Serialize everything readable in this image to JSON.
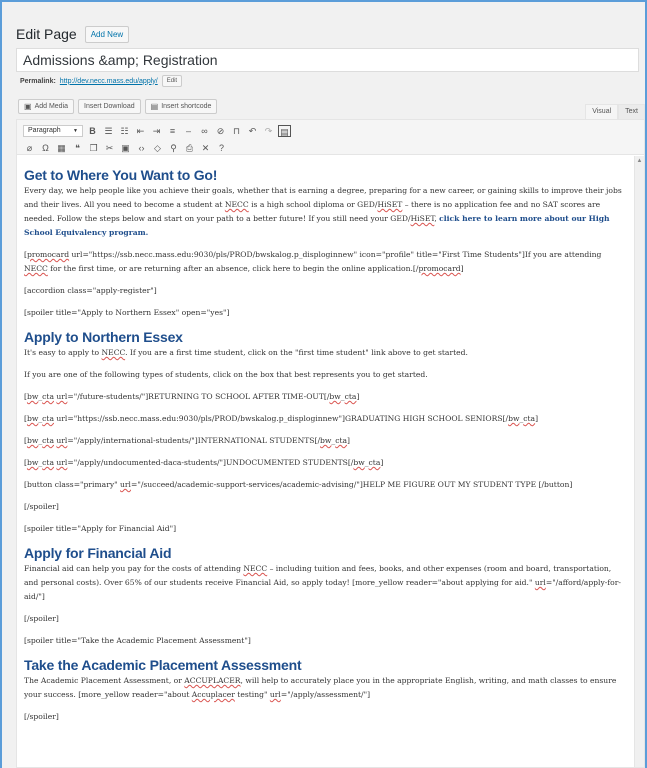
{
  "header": {
    "title": "Edit Page",
    "add_new": "Add New"
  },
  "post": {
    "title": "Admissions &amp; Registration",
    "permalink_label": "Permalink:",
    "permalink_url": "http://dev.necc.mass.edu/apply/",
    "edit_label": "Edit"
  },
  "media": {
    "add_media": "Add Media",
    "insert_download": "Insert Download",
    "insert_shortcode": "Insert shortcode"
  },
  "tabs": {
    "visual": "Visual",
    "text": "Text"
  },
  "toolbar": {
    "format": "Paragraph"
  },
  "content": {
    "h_get": "Get to Where You Want to Go!",
    "p_intro_1": "Every day, we help people like you achieve their goals, whether that is earning a degree, preparing for a new career, or gaining skills to improve their jobs and their lives. All you need to become a student at ",
    "necc": "NECC",
    "p_intro_2": " is a high school diploma or GED/",
    "hiset": "HiSET",
    "p_intro_3": " – there is no application fee and no SAT scores are needed. Follow the steps below and start on your path to a better future! If you still need your GED/",
    "p_intro_4": ", ",
    "p_intro_link": "click here to learn more about our High School Equivalency program.",
    "promo_1": "[",
    "promocard": "promocard",
    "promo_2": " url=\"https://ssb.necc.mass.edu:9030/pls/PROD/bwskalog.p_disploginnew\" icon=\"profile\" title=\"First Time Students\"]If you are attending ",
    "promo_3": " for the first time, or are returning after an absence, click here to begin the online application.[/",
    "promo_4": "]",
    "accordion": "[accordion class=\"apply-register\"]",
    "spoiler_apply": "[spoiler title=\"Apply to Northern Essex\" open=\"yes\"]",
    "h_apply": "Apply to Northern Essex",
    "p_apply_1": "It's easy to apply to ",
    "p_apply_2": ". If you are a first time student, click on the \"first time student\" link above to get started.",
    "p_types": "If you are one of the following types of students, click on the box that best represents you to get started.",
    "bw": "bw",
    "cta": "cta",
    "url": "url",
    "cta1_1": "=\"/future-students/\"]RETURNING TO SCHOOL AFTER TIME-OUT[/",
    "cta2_1": "=\"https://ssb.necc.mass.edu:9030/pls/PROD/bwskalog.p_disploginnew\"]GRADUATING HIGH SCHOOL SENIORS[/",
    "cta3_1": "=\"/apply/international-students/\"]INTERNATIONAL STUDENTS[/",
    "cta4_1": "=\"/apply/undocumented-daca-students/\"]UNDOCUMENTED STUDENTS[/",
    "button_1": "[button class=\"primary\" ",
    "button_2": "=\"/succeed/academic-support-services/academic-advising/\"]HELP ME FIGURE OUT MY STUDENT TYPE [/button]",
    "spoiler_close": "[/spoiler]",
    "spoiler_aid": "[spoiler title=\"Apply for Financial Aid\"]",
    "h_aid": "Apply for Financial Aid",
    "p_aid_1": "Financial aid can help you pay for the costs of attending ",
    "p_aid_2": " – including tuition and fees, books, and other expenses (room and board, transportation, and personal costs). Over 65% of our students receive Financial Aid, so apply today! [more_yellow reader=\"about applying for aid.\" ",
    "p_aid_3": "=\"/afford/apply-for-aid/\"]",
    "spoiler_assess": "[spoiler title=\"Take the Academic Placement Assessment\"]",
    "h_assess": "Take the Academic Placement Assessment",
    "p_assess_1": "The Academic Placement Assessment, or ",
    "accuplacer_caps": "ACCUPLACER",
    "p_assess_2": ", will help to accurately place you in the appropriate English, writing, and math classes to ensure your success. [more_yellow reader=\"about ",
    "accuplacer": "Accuplacer",
    "p_assess_3": " testing\" ",
    "p_assess_4": "=\"/apply/assessment/\"]"
  },
  "colors": {
    "heading": "#1f4e8c",
    "link": "#0073aa",
    "frame": "#5b9dd9"
  }
}
